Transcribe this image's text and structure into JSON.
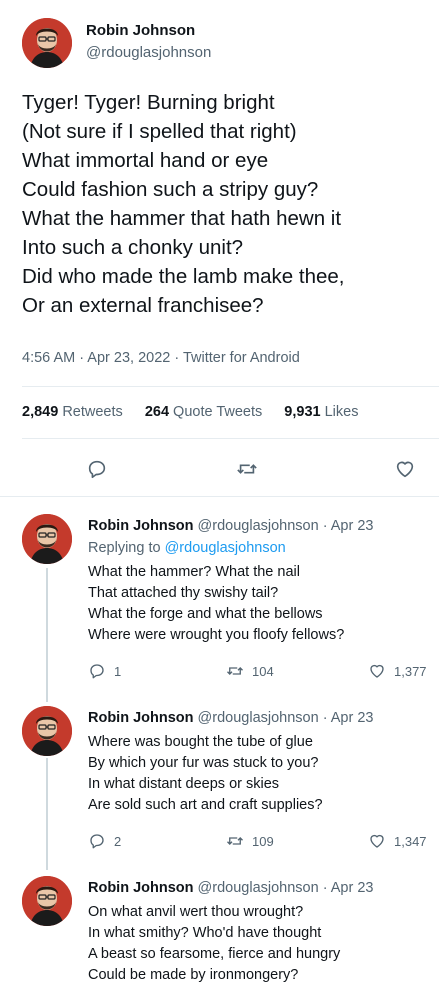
{
  "main_tweet": {
    "name": "Robin Johnson",
    "handle": "@rdouglasjohnson",
    "lines": [
      "Tyger! Tyger! Burning bright",
      "(Not sure if I spelled that right)",
      "What immortal hand or eye",
      "Could fashion such a stripy guy?",
      "What the hammer that hath hewn it",
      "Into such a chonky unit?",
      "Did who made the lamb make thee,",
      "Or an external franchisee?"
    ],
    "meta": "4:56 AM · Apr 23, 2022 · Twitter for Android",
    "stats": {
      "retweets_count": "2,849",
      "retweets_label": "Retweets",
      "quotes_count": "264",
      "quotes_label": "Quote Tweets",
      "likes_count": "9,931",
      "likes_label": "Likes"
    }
  },
  "replies": [
    {
      "name": "Robin Johnson",
      "handle_date": "@rdouglasjohnson · Apr 23",
      "replying_prefix": "Replying to",
      "replying_handle": "@rdouglasjohnson",
      "lines": [
        "What the hammer? What the nail",
        "That attached thy swishy tail?",
        "What the forge and what the bellows",
        "Where were wrought you floofy fellows?"
      ],
      "reply_count": "1",
      "retweet_count": "104",
      "like_count": "1,377"
    },
    {
      "name": "Robin Johnson",
      "handle_date": "@rdouglasjohnson · Apr 23",
      "lines": [
        "Where was bought the tube of glue",
        "By which your fur was stuck to you?",
        "In what distant deeps or skies",
        "Are sold such art and craft supplies?"
      ],
      "reply_count": "2",
      "retweet_count": "109",
      "like_count": "1,347"
    },
    {
      "name": "Robin Johnson",
      "handle_date": "@rdouglasjohnson · Apr 23",
      "lines": [
        "On what anvil wert thou wrought?",
        "In what smithy? Who'd have thought",
        "A beast so fearsome, fierce and hungry",
        "Could be made by ironmongery?"
      ]
    }
  ],
  "colors": {
    "accent": "#1d9bf0",
    "muted": "#536471",
    "text": "#0f1419"
  }
}
